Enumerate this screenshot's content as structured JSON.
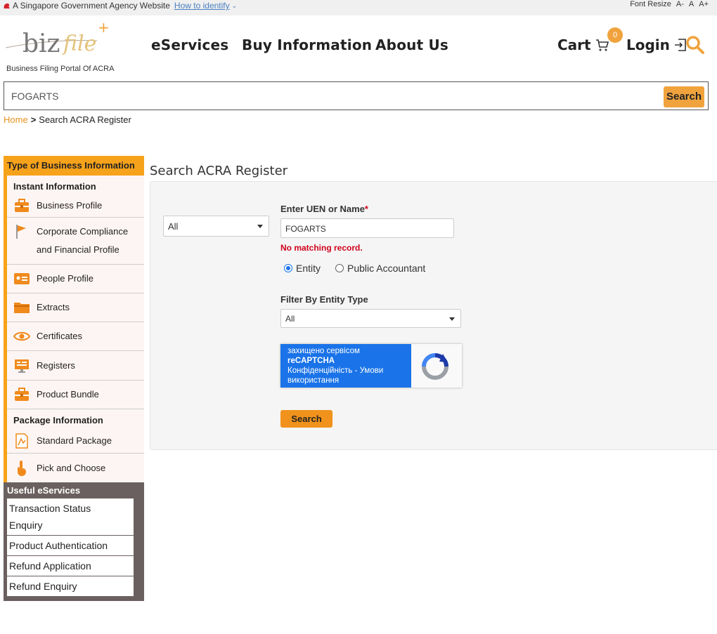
{
  "gov_banner": {
    "text": "A Singapore Government Agency Website",
    "identify": "How to identify",
    "font_resize": "Font Resize",
    "font_small": "A-",
    "font_normal": "A",
    "font_large": "A+"
  },
  "header": {
    "logo_text": "bizfile",
    "logo_plus": "+",
    "tagline": "Business Filing Portal Of ACRA",
    "nav": [
      "eServices",
      "Buy Information",
      "About Us"
    ],
    "cart": "Cart",
    "cart_count": "0",
    "login": "Login"
  },
  "global_search": {
    "value": "FOGARTS",
    "button": "Search"
  },
  "breadcrumb": {
    "home": "Home",
    "separator": ">",
    "current": "Search ACRA Register"
  },
  "sidebar": {
    "title": "Type of Business Information",
    "group1": "Instant Information",
    "items1": [
      {
        "label": "Business Profile",
        "icon": "briefcase-icon"
      },
      {
        "label": "Corporate Compliance and Financial Profile",
        "label_line1": "Corporate Compliance",
        "label_line2": "and Financial Profile",
        "icon": "flag-icon"
      },
      {
        "label": "People Profile",
        "icon": "id-card-icon"
      },
      {
        "label": "Extracts",
        "icon": "folder-icon"
      },
      {
        "label": "Certificates",
        "icon": "eye-icon"
      },
      {
        "label": "Registers",
        "icon": "monitor-icon"
      },
      {
        "label": "Product Bundle",
        "icon": "briefcase-icon"
      }
    ],
    "group2": "Package Information",
    "items2": [
      {
        "label": "Standard Package",
        "icon": "map-icon"
      },
      {
        "label": "Pick and Choose",
        "icon": "pointer-icon"
      }
    ],
    "useful_title": "Useful eServices",
    "useful_items": [
      "Transaction Status Enquiry",
      "Product Authentication",
      "Refund Application",
      "Refund Enquiry"
    ],
    "useful_item0_line1": "Transaction Status",
    "useful_item0_line2": "Enquiry"
  },
  "main": {
    "title": "Search ACRA Register",
    "category_select": "All",
    "uen_label": "Enter UEN or Name",
    "required_mark": "*",
    "uen_value": "FOGARTS",
    "error": "No matching record.",
    "radio_entity": "Entity",
    "radio_pa": "Public Accountant",
    "filter_label": "Filter By Entity Type",
    "filter_value": "All",
    "captcha_line1": "захищено сервісом",
    "captcha_line2": "reCAPTCHA",
    "captcha_line3": "Конфіденційність - Умови",
    "captcha_line4": "використання",
    "search_button": "Search"
  },
  "colors": {
    "accent": "#f0a33d",
    "sidebar_orange": "#f7a21b",
    "error_red": "#d0021b",
    "recaptcha_blue": "#1a73e8",
    "useful_bg": "#6b6060"
  }
}
